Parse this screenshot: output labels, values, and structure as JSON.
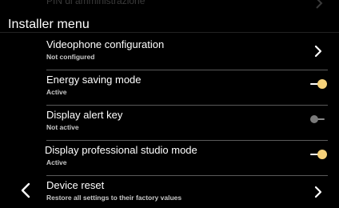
{
  "ghost_item": {
    "label": "PIN di amministrazione"
  },
  "header": {
    "title": "Installer menu"
  },
  "items": [
    {
      "label": "Videophone configuration",
      "status": "Not configured"
    },
    {
      "label": "Energy saving mode",
      "status": "Active",
      "toggle_on": true
    },
    {
      "label": "Display alert key",
      "status": "Not active",
      "toggle_on": false
    },
    {
      "label": "Display professional studio mode",
      "status": "Active",
      "toggle_on": true
    },
    {
      "label": "Device reset",
      "status": "Restore all settings to their factory values"
    }
  ],
  "colors": {
    "background": "#000000",
    "text": "#ffffff",
    "toggle_on_knob": "#f6d27a",
    "toggle_off": "#7a7a7a",
    "divider": "#5a5a5a"
  },
  "icons": {
    "back": "chevron-left-icon",
    "forward": "chevron-right-icon"
  }
}
